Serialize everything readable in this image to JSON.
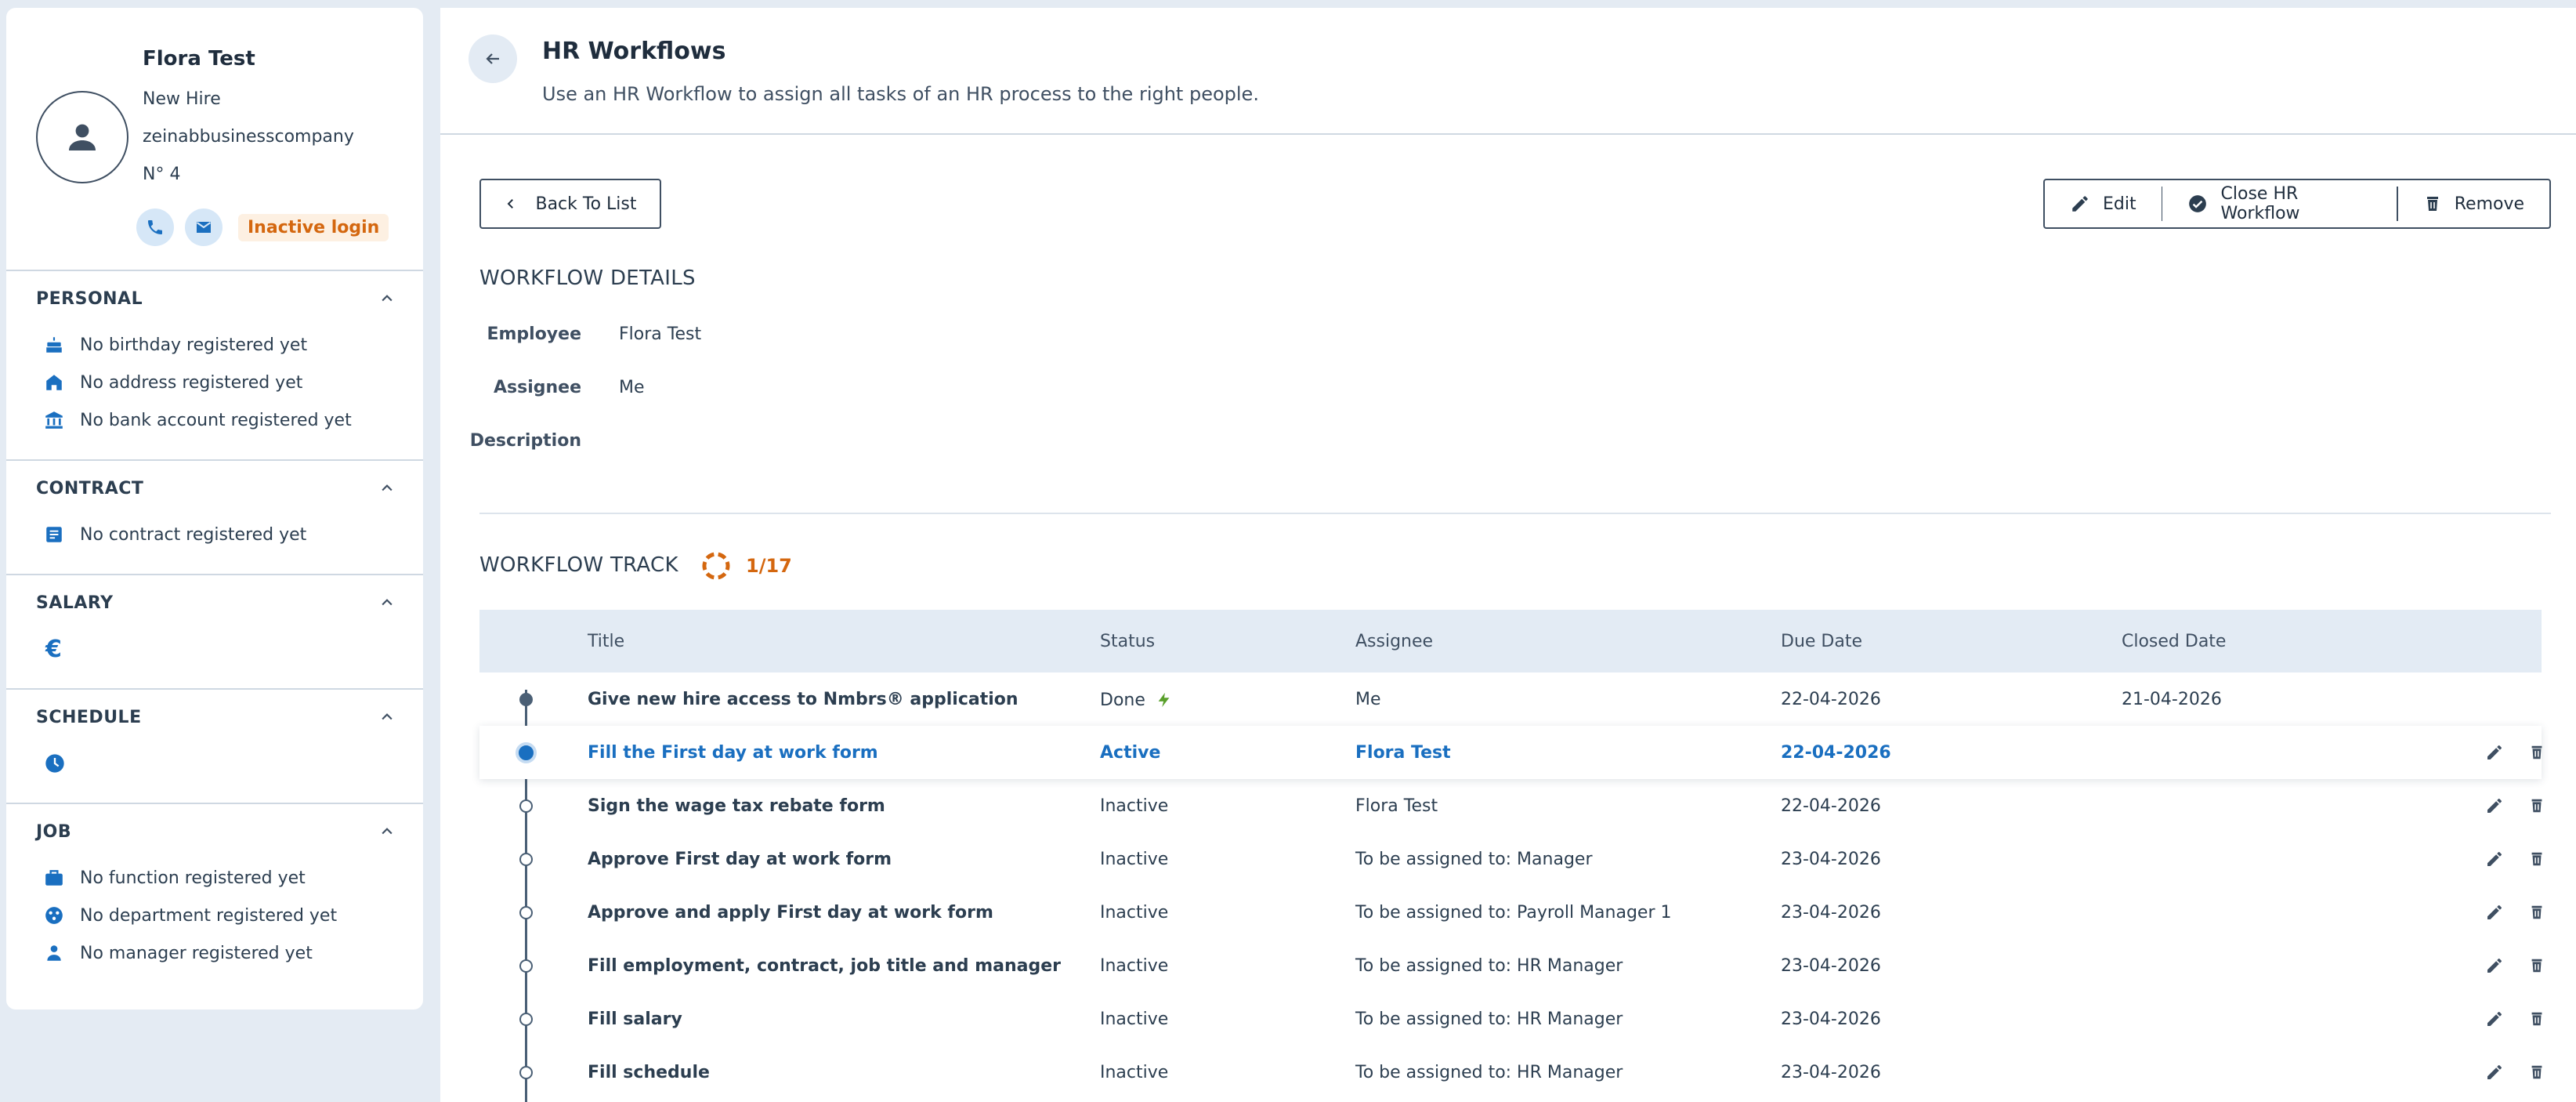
{
  "profile": {
    "name": "Flora Test",
    "role": "New Hire",
    "company": "zeinabbusinesscompany",
    "number": "N° 4",
    "login_status": "Inactive login",
    "sections": {
      "personal": {
        "title": "PERSONAL",
        "items": [
          "No birthday registered yet",
          "No address registered yet",
          "No bank account registered yet"
        ]
      },
      "contract": {
        "title": "CONTRACT",
        "items": [
          "No contract registered yet"
        ]
      },
      "salary": {
        "title": "SALARY",
        "icon": "euro-icon"
      },
      "schedule": {
        "title": "SCHEDULE",
        "icon": "clock-icon"
      },
      "job": {
        "title": "JOB",
        "items": [
          "No function registered yet",
          "No department registered yet",
          "No manager registered yet"
        ]
      }
    }
  },
  "header": {
    "title": "HR Workflows",
    "subtitle": "Use an HR Workflow to assign all tasks of an HR process to the right people."
  },
  "toolbar": {
    "back_label": "Back To List",
    "edit_label": "Edit",
    "close_label": "Close HR Workflow",
    "remove_label": "Remove"
  },
  "details": {
    "section_title": "WORKFLOW DETAILS",
    "employee_label": "Employee",
    "employee_value": "Flora Test",
    "assignee_label": "Assignee",
    "assignee_value": "Me",
    "description_label": "Description",
    "description_value": ""
  },
  "track": {
    "section_title": "WORKFLOW TRACK",
    "progress": "1/17",
    "progress_done": 1,
    "progress_total": 17,
    "columns": [
      "Title",
      "Status",
      "Assignee",
      "Due Date",
      "Closed Date"
    ],
    "rows": [
      {
        "title": "Give new hire access to Nmbrs® application",
        "status": "Done",
        "assignee": "Me",
        "due": "22-04-2026",
        "closed": "21-04-2026"
      },
      {
        "title": "Fill the First day at work form",
        "status": "Active",
        "assignee": "Flora Test",
        "due": "22-04-2026",
        "closed": ""
      },
      {
        "title": "Sign the wage tax rebate form",
        "status": "Inactive",
        "assignee": "Flora Test",
        "due": "22-04-2026",
        "closed": ""
      },
      {
        "title": "Approve First day at work form",
        "status": "Inactive",
        "assignee": "To be assigned to: Manager",
        "due": "23-04-2026",
        "closed": ""
      },
      {
        "title": "Approve and apply First day at work form",
        "status": "Inactive",
        "assignee": "To be assigned to: Payroll Manager 1",
        "due": "23-04-2026",
        "closed": ""
      },
      {
        "title": "Fill employment, contract, job title and manager",
        "status": "Inactive",
        "assignee": "To be assigned to: HR Manager",
        "due": "23-04-2026",
        "closed": ""
      },
      {
        "title": "Fill salary",
        "status": "Inactive",
        "assignee": "To be assigned to: HR Manager",
        "due": "23-04-2026",
        "closed": ""
      },
      {
        "title": "Fill schedule",
        "status": "Inactive",
        "assignee": "To be assigned to: HR Manager",
        "due": "23-04-2026",
        "closed": ""
      }
    ]
  },
  "colors": {
    "accent": "#1a6fc0",
    "warning": "#d4670f",
    "done_bolt": "#5aa02c",
    "text": "#2c3e50"
  }
}
